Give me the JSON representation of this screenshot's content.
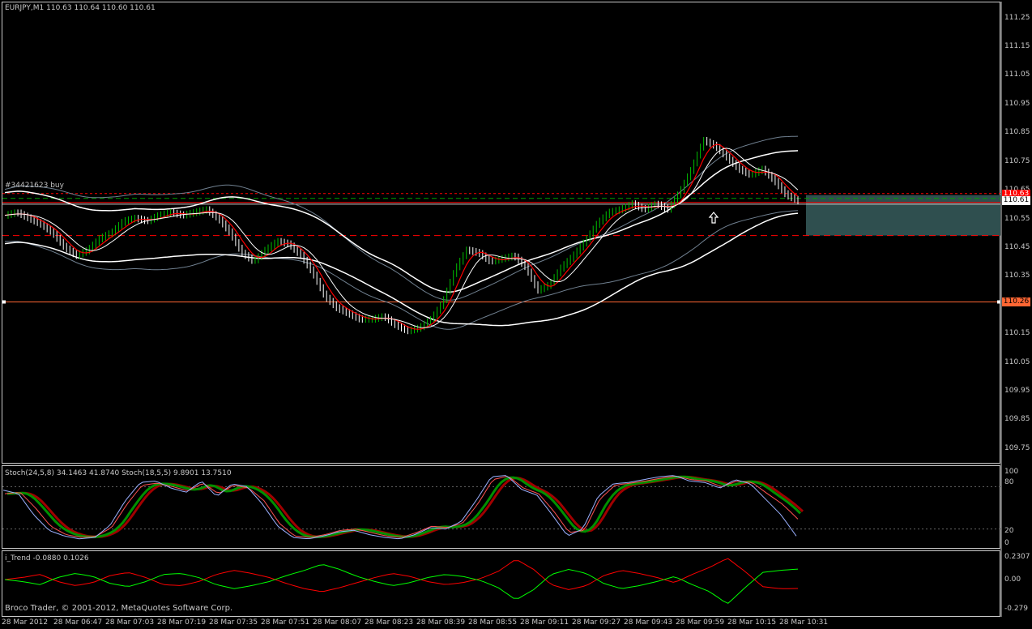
{
  "header": {
    "symbol_info": "EURJPY,M1  110.63 110.64 110.60 110.61",
    "order_label": "#34421623 buy",
    "stoch_label": "Stoch(24,5,8) 34.1463 41.8740  Stoch(18,5,5) 9.8901 13.7510",
    "trend_label": "i_Trend -0.0880 0.1026",
    "copyright": "Broco Trader, © 2001-2012, MetaQuotes Software Corp."
  },
  "price_axis": {
    "labels": [
      "111.25",
      "111.15",
      "111.05",
      "110.95",
      "110.85",
      "110.75",
      "110.65",
      "110.55",
      "110.45",
      "110.35",
      "110.26",
      "110.15",
      "110.05",
      "109.95",
      "109.85",
      "109.75"
    ],
    "bid_tag": "110.61",
    "order_tag": "110.63",
    "level_tag": "110.26"
  },
  "stoch_axis": {
    "labels": [
      "100",
      "80",
      "20",
      "0"
    ]
  },
  "trend_axis": {
    "labels": [
      "0.2307",
      "0.00",
      "-0.279"
    ]
  },
  "time_axis": {
    "labels": [
      "28 Mar 2012",
      "28 Mar 06:47",
      "28 Mar 07:03",
      "28 Mar 07:19",
      "28 Mar 07:35",
      "28 Mar 07:51",
      "28 Mar 08:07",
      "28 Mar 08:23",
      "28 Mar 08:39",
      "28 Mar 08:55",
      "28 Mar 09:11",
      "28 Mar 09:27",
      "28 Mar 09:43",
      "28 Mar 09:59",
      "28 Mar 10:15",
      "28 Mar 10:31"
    ]
  },
  "colors": {
    "background": "#000000",
    "bull_candle": "#00c000",
    "bear_candle": "#ffffff",
    "fast_ma": "#ff0000",
    "slow_ma": "#ffffff",
    "bollinger": "#708090",
    "order_line": "#ff0000",
    "stop_line": "#ff0000",
    "level_line": "#ff6633",
    "tp_zone": "#2f4f4f",
    "trend_up": "#00ff00",
    "trend_down": "#ff0000"
  },
  "chart_data": [
    {
      "type": "candlestick",
      "title": "EURJPY,M1",
      "ylim": [
        109.7,
        111.3
      ],
      "levels": {
        "order_open": 110.63,
        "bid": 110.61,
        "stop": 110.49,
        "horizontal_level": 110.26
      },
      "series": [
        {
          "name": "close",
          "values": [
            110.56,
            110.57,
            110.55,
            110.53,
            110.5,
            110.45,
            110.42,
            110.44,
            110.48,
            110.5,
            110.54,
            110.55,
            110.54,
            110.56,
            110.57,
            110.56,
            110.57,
            110.58,
            110.55,
            110.5,
            110.43,
            110.4,
            110.44,
            110.47,
            110.46,
            110.42,
            110.36,
            110.28,
            110.24,
            110.22,
            110.2,
            110.2,
            110.21,
            110.18,
            110.16,
            110.17,
            110.2,
            110.26,
            110.37,
            110.44,
            110.43,
            110.4,
            110.41,
            110.42,
            110.38,
            110.3,
            110.32,
            110.38,
            110.42,
            110.47,
            110.53,
            110.57,
            110.58,
            110.6,
            110.58,
            110.6,
            110.58,
            110.64,
            110.72,
            110.82,
            110.8,
            110.76,
            110.72,
            110.7,
            110.72,
            110.68,
            110.63,
            110.61
          ]
        }
      ]
    },
    {
      "type": "line",
      "title": "Stoch(24,5,8)",
      "ylim": [
        0,
        100
      ],
      "series": [
        {
          "name": "Stoch(24,5,8)",
          "values": [
            70,
            72,
            50,
            24,
            12,
            8,
            10,
            22,
            55,
            82,
            85,
            80,
            74,
            85,
            70,
            82,
            78,
            60,
            28,
            10,
            8,
            12,
            18,
            20,
            15,
            10,
            8,
            15,
            24,
            22,
            28,
            55,
            90,
            95,
            78,
            70,
            45,
            15,
            18,
            62,
            82,
            85,
            88,
            92,
            95,
            90,
            88,
            80,
            88,
            86,
            70,
            55,
            34
          ]
        },
        {
          "name": "Stoch(18,5,5)",
          "values": [
            75,
            70,
            40,
            18,
            10,
            6,
            8,
            25,
            60,
            86,
            88,
            78,
            72,
            88,
            66,
            84,
            80,
            55,
            24,
            8,
            6,
            10,
            16,
            18,
            12,
            8,
            6,
            12,
            22,
            20,
            30,
            60,
            94,
            96,
            76,
            68,
            40,
            10,
            20,
            66,
            84,
            86,
            90,
            94,
            96,
            88,
            86,
            78,
            90,
            84,
            62,
            40,
            10
          ]
        }
      ]
    },
    {
      "type": "line",
      "title": "i_Trend",
      "ylim": [
        -0.279,
        0.2307
      ],
      "series": [
        {
          "name": "i_Trend -0.0880",
          "values": [
            0,
            0.02,
            0.05,
            -0.02,
            -0.06,
            -0.03,
            0.04,
            0.07,
            0.02,
            -0.05,
            -0.06,
            -0.02,
            0.05,
            0.09,
            0.06,
            0.02,
            -0.04,
            -0.09,
            -0.12,
            -0.08,
            -0.03,
            0.02,
            0.06,
            0.03,
            -0.02,
            -0.05,
            -0.03,
            0.01,
            0.08,
            0.2,
            0.1,
            -0.05,
            -0.1,
            -0.06,
            0.04,
            0.09,
            0.06,
            0.02,
            -0.03,
            0.05,
            0.12,
            0.21,
            0.08,
            -0.07,
            -0.09,
            -0.088
          ]
        },
        {
          "name": "i_Trend 0.1026",
          "values": [
            0,
            -0.02,
            -0.05,
            0.02,
            0.06,
            0.03,
            -0.04,
            -0.07,
            -0.02,
            0.05,
            0.06,
            0.02,
            -0.05,
            -0.09,
            -0.06,
            -0.02,
            0.04,
            0.09,
            0.15,
            0.1,
            0.03,
            -0.02,
            -0.06,
            -0.03,
            0.02,
            0.05,
            0.03,
            -0.01,
            -0.08,
            -0.2,
            -0.1,
            0.05,
            0.1,
            0.06,
            -0.04,
            -0.09,
            -0.06,
            -0.02,
            0.03,
            -0.05,
            -0.12,
            -0.24,
            -0.08,
            0.07,
            0.09,
            0.1026
          ]
        }
      ]
    }
  ]
}
